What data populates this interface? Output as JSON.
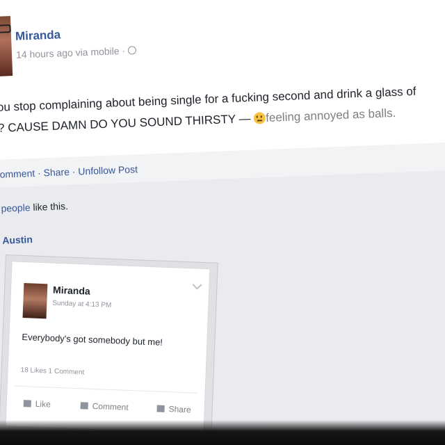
{
  "post": {
    "author": "Miranda",
    "meta": "14 hours ago via mobile ·",
    "status_line_1": "ou stop complaining about being single for a fucking second and drink a glass of",
    "status_line_2": "? CAUSE DAMN DO YOU SOUND THIRSTY —",
    "feeling": "feeling annoyed as balls.",
    "actions": "omment · Share · Unfollow Post",
    "likes_link": "people",
    "likes_rest": " like this.",
    "commenter": "Austin"
  },
  "shared_post": {
    "author": "Miranda",
    "meta": "Sunday at 4:13 PM",
    "text": "Everybody's got somebody but me!",
    "counts": "18 Likes  1 Comment",
    "like_label": "Like",
    "comment_label": "Comment",
    "share_label": "Share"
  },
  "icons": [
    "globe-icon",
    "emoji-icon",
    "chevron-down-icon",
    "like-icon",
    "comment-icon",
    "share-icon"
  ],
  "colors": {
    "link": "#365899",
    "muted": "#90949c",
    "background": "#e9ebee"
  }
}
